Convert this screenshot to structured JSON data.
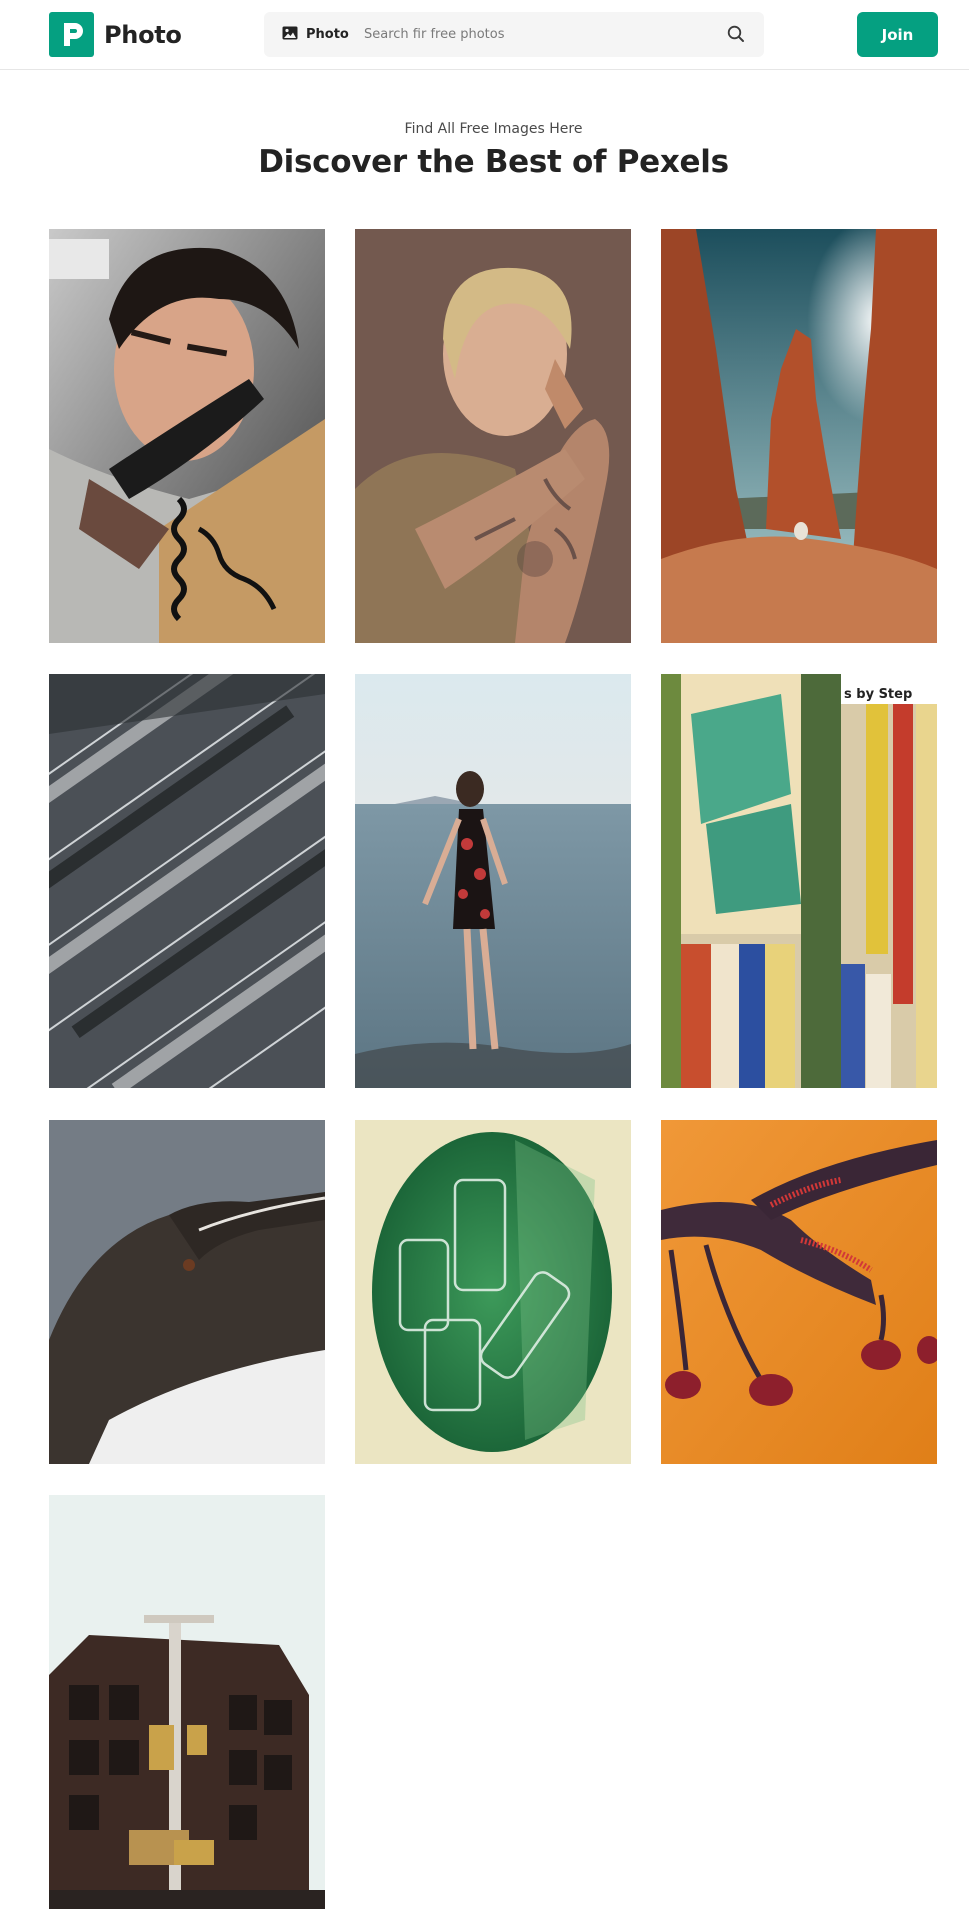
{
  "header": {
    "logo_text": "Photo",
    "search": {
      "type_label": "Photo",
      "placeholder": "Search fir free photos"
    },
    "join_label": "Join"
  },
  "hero": {
    "eyebrow": "Find All Free Images Here",
    "title": "Discover the Best of Pexels"
  },
  "colors": {
    "accent": "#05a081"
  },
  "gallery": [
    {
      "subject": "man on telephone"
    },
    {
      "subject": "tattooed man in profile"
    },
    {
      "subject": "desert rock spire"
    },
    {
      "subject": "aerial parking lot"
    },
    {
      "subject": "woman wading in sea"
    },
    {
      "subject": "torn paper collage",
      "text": "s by Step"
    },
    {
      "subject": "seabird close-up"
    },
    {
      "subject": "glasses on green oval"
    },
    {
      "subject": "insect on orange"
    },
    {
      "subject": "city building with traffic light"
    }
  ]
}
